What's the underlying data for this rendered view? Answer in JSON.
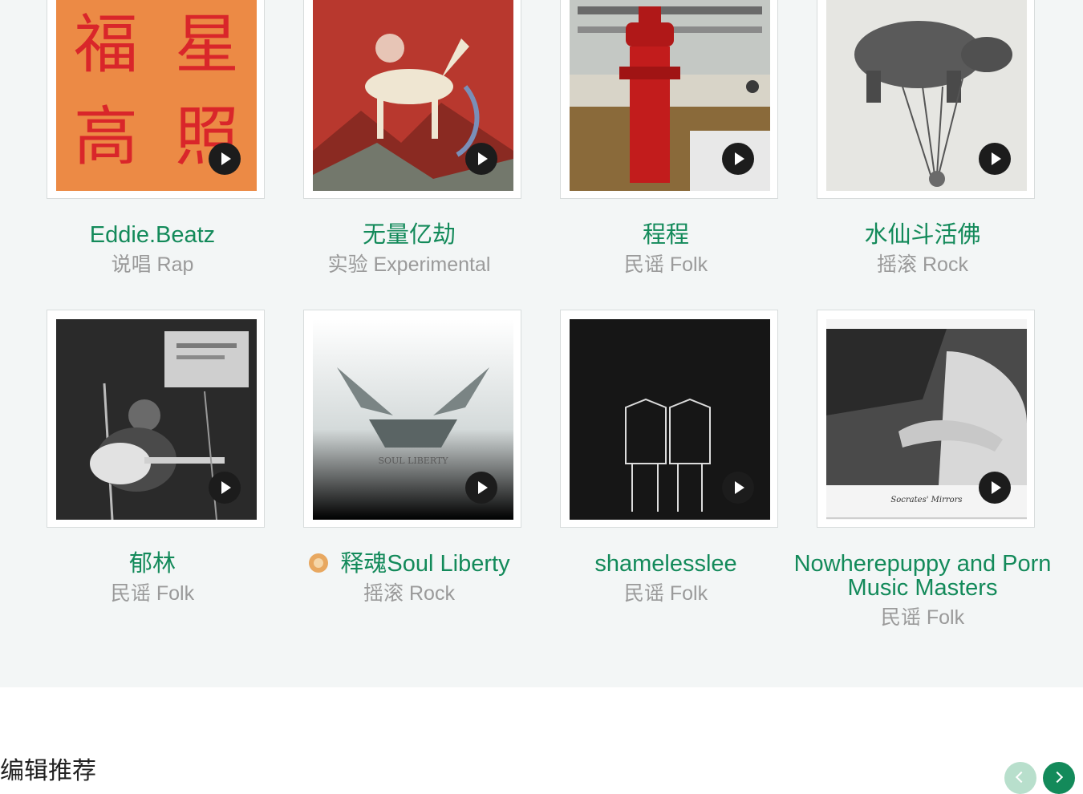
{
  "artists": [
    {
      "name": "Eddie.Beatz",
      "genre": "说唱 Rap",
      "cover_text": [
        "福",
        "星",
        "高",
        "照"
      ]
    },
    {
      "name": "无量亿劫",
      "genre": "实验 Experimental"
    },
    {
      "name": "程程",
      "genre": "民谣 Folk"
    },
    {
      "name": "水仙斗活佛",
      "genre": "摇滚 Rock"
    },
    {
      "name": "郁林",
      "genre": "民谣 Folk"
    },
    {
      "name": "释魂Soul Liberty",
      "genre": "摇滚 Rock",
      "cover_text": "SOUL LIBERTY"
    },
    {
      "name": "shamelesslee",
      "genre": "民谣 Folk"
    },
    {
      "name": "Nowherepuppy and Porn Music Masters",
      "genre": "民谣 Folk",
      "cover_text": "Socrates' Mirrors"
    }
  ],
  "section": {
    "heading": "编辑推荐"
  },
  "colors": {
    "accent": "#138a5a",
    "background": "#f3f6f6"
  }
}
